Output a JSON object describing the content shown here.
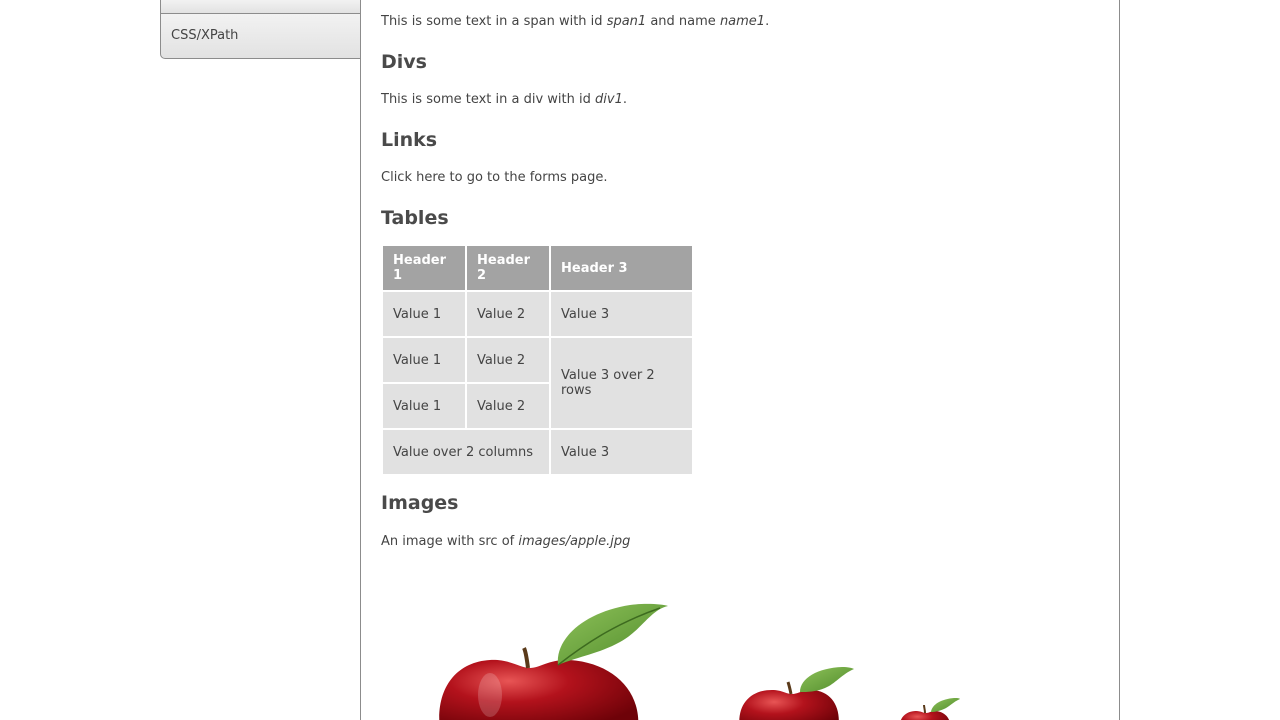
{
  "sidebar": {
    "items": [
      {
        "label": ""
      },
      {
        "label": "CSS/XPath"
      }
    ]
  },
  "spans": {
    "text_before": "This is some text in a span with id ",
    "id": "span1",
    "text_mid": " and name ",
    "name": "name1",
    "text_end": "."
  },
  "divs": {
    "heading": "Divs",
    "text_before": "This is some text in a div with id ",
    "id": "div1",
    "text_end": "."
  },
  "links": {
    "heading": "Links",
    "text": "Click here to go to the forms page."
  },
  "tables": {
    "heading": "Tables",
    "headers": [
      "Header 1",
      "Header 2",
      "Header 3"
    ],
    "rows": [
      [
        "Value 1",
        "Value 2",
        "Value 3"
      ],
      [
        "Value 1",
        "Value 2",
        "Value 3 over 2 rows"
      ],
      [
        "Value 1",
        "Value 2"
      ],
      [
        "Value over 2 columns",
        "Value 3"
      ]
    ]
  },
  "images": {
    "heading": "Images",
    "text_before": "An image with src of ",
    "src": "images/apple.jpg"
  }
}
